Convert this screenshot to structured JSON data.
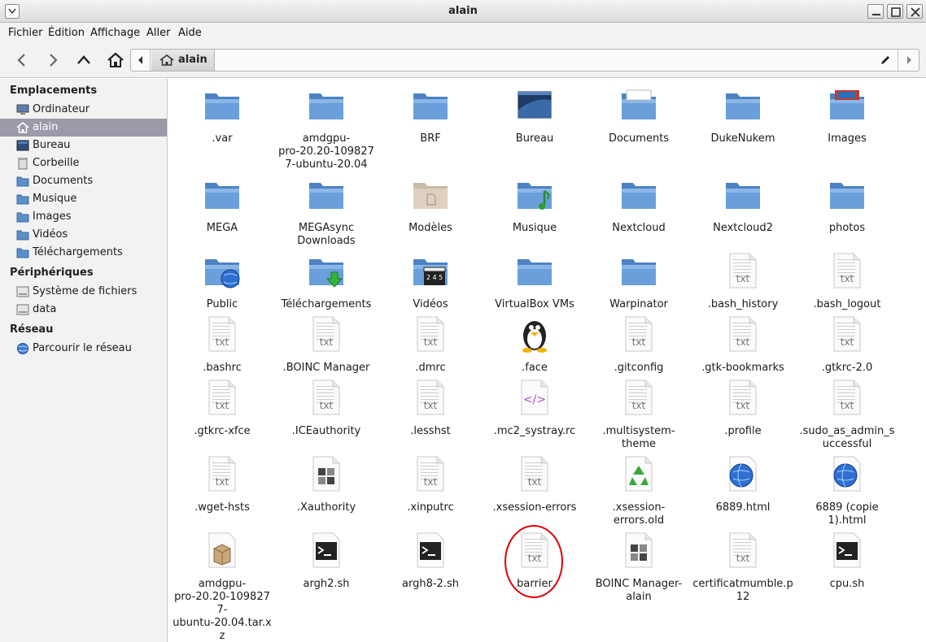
{
  "window": {
    "title": "alain"
  },
  "menubar": {
    "items": [
      "Fichier",
      "Édition",
      "Affichage",
      "Aller",
      "Aide"
    ]
  },
  "toolbar": {
    "back_icon": "arrow-left-icon",
    "forward_icon": "arrow-right-icon",
    "up_icon": "arrow-up-icon",
    "home_icon": "home-icon"
  },
  "pathbar": {
    "crumb": "alain"
  },
  "sidebar": {
    "sections": [
      {
        "title": "Emplacements",
        "items": [
          {
            "label": "Ordinateur",
            "icon": "computer-icon"
          },
          {
            "label": "alain",
            "icon": "home-icon",
            "selected": true
          },
          {
            "label": "Bureau",
            "icon": "desktop-icon"
          },
          {
            "label": "Corbeille",
            "icon": "trash-icon"
          },
          {
            "label": "Documents",
            "icon": "folder-icon"
          },
          {
            "label": "Musique",
            "icon": "folder-icon"
          },
          {
            "label": "Images",
            "icon": "folder-icon"
          },
          {
            "label": "Vidéos",
            "icon": "folder-icon"
          },
          {
            "label": "Téléchargements",
            "icon": "folder-icon"
          }
        ]
      },
      {
        "title": "Périphériques",
        "items": [
          {
            "label": "Système de fichiers",
            "icon": "drive-icon"
          },
          {
            "label": "data",
            "icon": "drive-icon"
          }
        ]
      },
      {
        "title": "Réseau",
        "items": [
          {
            "label": "Parcourir le réseau",
            "icon": "network-icon"
          }
        ]
      }
    ]
  },
  "files": [
    {
      "name": ".var",
      "icon": "folder"
    },
    {
      "name": "amdgpu-pro-20.20-1098277-ubuntu-20.04",
      "display": [
        "amdgpu-",
        "pro-20.20-109827",
        "7-ubuntu-20.04"
      ],
      "icon": "folder"
    },
    {
      "name": "BRF",
      "icon": "folder"
    },
    {
      "name": "Bureau",
      "icon": "desktop"
    },
    {
      "name": "Documents",
      "icon": "folder-docs"
    },
    {
      "name": "DukeNukem",
      "icon": "folder"
    },
    {
      "name": "Images",
      "icon": "folder-images"
    },
    {
      "name": "MEGA",
      "icon": "folder"
    },
    {
      "name": "MEGAsync Downloads",
      "display": [
        "MEGAsync",
        "Downloads"
      ],
      "icon": "folder"
    },
    {
      "name": "Modèles",
      "icon": "folder-templates"
    },
    {
      "name": "Musique",
      "icon": "folder-music"
    },
    {
      "name": "Nextcloud",
      "icon": "folder"
    },
    {
      "name": "Nextcloud2",
      "icon": "folder"
    },
    {
      "name": "photos",
      "icon": "folder"
    },
    {
      "name": "Public",
      "icon": "folder-public"
    },
    {
      "name": "Téléchargements",
      "icon": "folder-download"
    },
    {
      "name": "Vidéos",
      "icon": "folder-videos"
    },
    {
      "name": "VirtualBox VMs",
      "icon": "folder"
    },
    {
      "name": "Warpinator",
      "icon": "folder"
    },
    {
      "name": ".bash_history",
      "icon": "txt"
    },
    {
      "name": ".bash_logout",
      "icon": "txt"
    },
    {
      "name": ".bashrc",
      "icon": "txt"
    },
    {
      "name": ".BOINC Manager",
      "icon": "txt"
    },
    {
      "name": ".dmrc",
      "icon": "txt"
    },
    {
      "name": ".face",
      "icon": "tux"
    },
    {
      "name": ".gitconfig",
      "icon": "txt"
    },
    {
      "name": ".gtk-bookmarks",
      "icon": "txt"
    },
    {
      "name": ".gtkrc-2.0",
      "icon": "txt"
    },
    {
      "name": ".gtkrc-xfce",
      "icon": "txt"
    },
    {
      "name": ".ICEauthority",
      "icon": "txt"
    },
    {
      "name": ".lesshst",
      "icon": "txt"
    },
    {
      "name": ".mc2_systray.rc",
      "icon": "code"
    },
    {
      "name": ".multisystem-theme",
      "display": [
        ".multisystem-",
        "theme"
      ],
      "icon": "txt"
    },
    {
      "name": ".profile",
      "icon": "txt"
    },
    {
      "name": ".sudo_as_admin_successful",
      "display": [
        ".sudo_as_admin_s",
        "uccessful"
      ],
      "icon": "txt"
    },
    {
      "name": ".wget-hsts",
      "icon": "txt"
    },
    {
      "name": ".Xauthority",
      "icon": "binary"
    },
    {
      "name": ".xinputrc",
      "icon": "txt"
    },
    {
      "name": ".xsession-errors",
      "icon": "txt"
    },
    {
      "name": ".xsession-errors.old",
      "display": [
        ".xsession-",
        "errors.old"
      ],
      "icon": "recycle"
    },
    {
      "name": "6889.html",
      "icon": "html"
    },
    {
      "name": "6889 (copie 1).html",
      "display": [
        "6889 (copie",
        "1).html"
      ],
      "icon": "html"
    },
    {
      "name": "amdgpu-pro-20.20-1098277-ubuntu-20.04.tar.xz",
      "display": [
        "amdgpu-",
        "pro-20.20-109827",
        "7-",
        "ubuntu-20.04.tar.x",
        "z"
      ],
      "icon": "archive"
    },
    {
      "name": "argh2.sh",
      "icon": "script"
    },
    {
      "name": "argh8-2.sh",
      "icon": "script"
    },
    {
      "name": "barrier",
      "icon": "txt"
    },
    {
      "name": "BOINC Manager-alain",
      "display": [
        "BOINC Manager-",
        "alain"
      ],
      "icon": "binary"
    },
    {
      "name": "certificatmumble.p12",
      "display": [
        "certificatmumble.p",
        "12"
      ],
      "icon": "txt"
    },
    {
      "name": "cpu.sh",
      "icon": "script"
    }
  ],
  "annotation": {
    "circled_file": "barrier",
    "color": "#e00000"
  },
  "colors": {
    "folder": "#5b8fc9",
    "selection": "#9a9aa8"
  }
}
